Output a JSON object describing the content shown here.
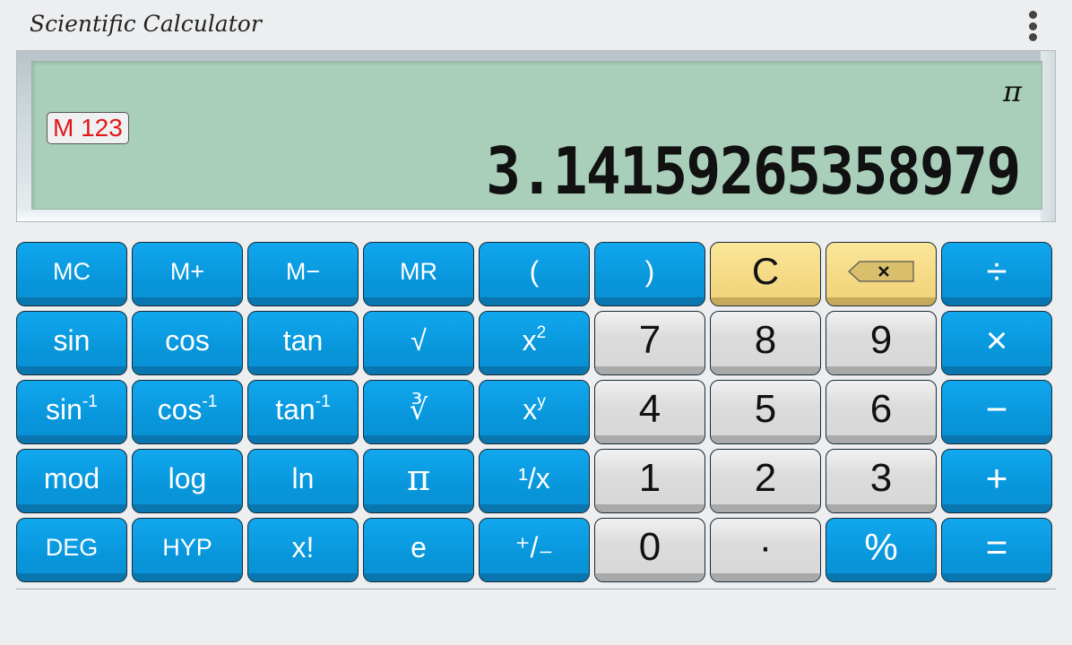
{
  "app": {
    "title": "Scientific Calculator",
    "menu_icon": "more-vert-icon"
  },
  "display": {
    "memory_badge": "M 123",
    "expression": "π",
    "value": "3.14159265358979"
  },
  "colors": {
    "function_key": "#0896db",
    "digit_key": "#dcdcdc",
    "clear_key": "#f4d983",
    "lcd": "#a9cfba",
    "memory_text": "#e21818"
  },
  "keys": [
    {
      "id": "mc",
      "label": "MC",
      "style": "blue",
      "size": "sm"
    },
    {
      "id": "m-plus",
      "label": "M+",
      "style": "blue",
      "size": "sm"
    },
    {
      "id": "m-minus",
      "label": "M−",
      "style": "blue",
      "size": "sm"
    },
    {
      "id": "mr",
      "label": "MR",
      "style": "blue",
      "size": "sm"
    },
    {
      "id": "open-paren",
      "label": "(",
      "style": "blue",
      "size": "md"
    },
    {
      "id": "close-paren",
      "label": ")",
      "style": "blue",
      "size": "md"
    },
    {
      "id": "clear",
      "label": "C",
      "style": "yellow",
      "size": "lg"
    },
    {
      "id": "backspace",
      "label": "",
      "icon": "backspace-icon",
      "style": "yellow",
      "size": "md"
    },
    {
      "id": "divide",
      "label": "÷",
      "style": "blue",
      "size": "lg"
    },
    {
      "id": "sin",
      "label": "sin",
      "style": "blue",
      "size": "md"
    },
    {
      "id": "cos",
      "label": "cos",
      "style": "blue",
      "size": "md"
    },
    {
      "id": "tan",
      "label": "tan",
      "style": "blue",
      "size": "md"
    },
    {
      "id": "sqrt",
      "label": "√",
      "style": "blue",
      "size": "md"
    },
    {
      "id": "square",
      "label": "x",
      "sup": "2",
      "style": "blue",
      "size": "md"
    },
    {
      "id": "digit-7",
      "label": "7",
      "style": "gray",
      "size": "num"
    },
    {
      "id": "digit-8",
      "label": "8",
      "style": "gray",
      "size": "num"
    },
    {
      "id": "digit-9",
      "label": "9",
      "style": "gray",
      "size": "num"
    },
    {
      "id": "multiply",
      "label": "×",
      "style": "blue",
      "size": "lg"
    },
    {
      "id": "asin",
      "label": "sin",
      "sup": "-1",
      "style": "blue",
      "size": "md"
    },
    {
      "id": "acos",
      "label": "cos",
      "sup": "-1",
      "style": "blue",
      "size": "md"
    },
    {
      "id": "atan",
      "label": "tan",
      "sup": "-1",
      "style": "blue",
      "size": "md"
    },
    {
      "id": "cbrt",
      "label": "∛",
      "style": "blue",
      "size": "md"
    },
    {
      "id": "power",
      "label": "x",
      "sup": "y",
      "style": "blue",
      "size": "md"
    },
    {
      "id": "digit-4",
      "label": "4",
      "style": "gray",
      "size": "num"
    },
    {
      "id": "digit-5",
      "label": "5",
      "style": "gray",
      "size": "num"
    },
    {
      "id": "digit-6",
      "label": "6",
      "style": "gray",
      "size": "num"
    },
    {
      "id": "subtract",
      "label": "−",
      "style": "blue",
      "size": "lg"
    },
    {
      "id": "mod",
      "label": "mod",
      "style": "blue",
      "size": "md"
    },
    {
      "id": "log",
      "label": "log",
      "style": "blue",
      "size": "md"
    },
    {
      "id": "ln",
      "label": "ln",
      "style": "blue",
      "size": "md"
    },
    {
      "id": "pi",
      "label": "π",
      "style": "blue",
      "size": "pi"
    },
    {
      "id": "reciprocal",
      "label": "¹/x",
      "style": "blue",
      "size": "md"
    },
    {
      "id": "digit-1",
      "label": "1",
      "style": "gray",
      "size": "num"
    },
    {
      "id": "digit-2",
      "label": "2",
      "style": "gray",
      "size": "num"
    },
    {
      "id": "digit-3",
      "label": "3",
      "style": "gray",
      "size": "num"
    },
    {
      "id": "add",
      "label": "+",
      "style": "blue",
      "size": "lg"
    },
    {
      "id": "deg",
      "label": "DEG",
      "style": "blue",
      "size": "sm"
    },
    {
      "id": "hyp",
      "label": "HYP",
      "style": "blue",
      "size": "sm"
    },
    {
      "id": "factorial",
      "label": "x!",
      "style": "blue",
      "size": "md"
    },
    {
      "id": "euler",
      "label": "e",
      "style": "blue",
      "size": "md"
    },
    {
      "id": "negate",
      "label": "⁺/₋",
      "style": "blue",
      "size": "md"
    },
    {
      "id": "digit-0",
      "label": "0",
      "style": "gray",
      "size": "num"
    },
    {
      "id": "decimal",
      "label": "·",
      "style": "gray",
      "size": "num"
    },
    {
      "id": "percent",
      "label": "%",
      "style": "blue",
      "size": "lg"
    },
    {
      "id": "equals",
      "label": "=",
      "style": "blue",
      "size": "lg"
    }
  ]
}
